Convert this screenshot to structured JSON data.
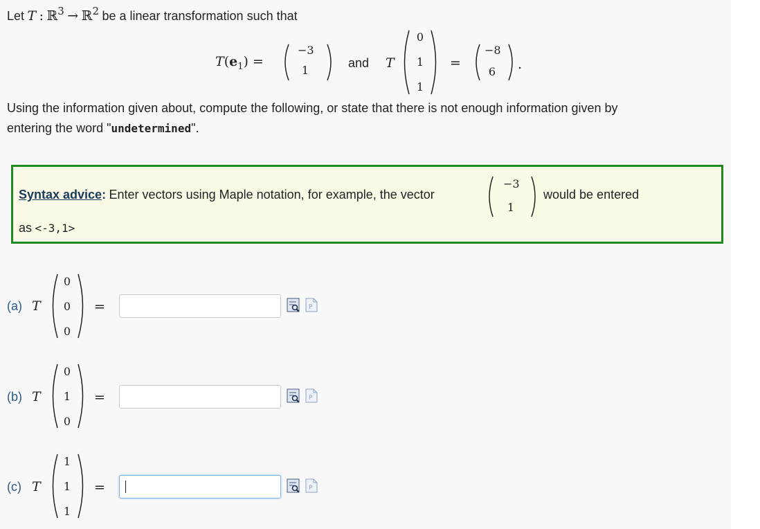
{
  "problem": {
    "intro_let": "Let",
    "T": "T",
    "colon": ":",
    "R": "ℝ",
    "dim3": "3",
    "arrow": "→",
    "dim2": "2",
    "intro_rest": "be a linear transformation such that",
    "te1_T": "T",
    "te1_open": "(",
    "te1_e": "e",
    "te1_sub": "1",
    "te1_close": ") =",
    "vec_e1_image": [
      "−3",
      "1"
    ],
    "and": "and",
    "given_T": "T",
    "given_input": [
      "0",
      "1",
      "1"
    ],
    "equals": "=",
    "given_output": [
      "−8",
      "6"
    ],
    "period": ".",
    "instruction_line1": "Using the information given about, compute the following, or state that there is not enough information given by",
    "instruction_line2_pre": "entering the word \"",
    "instruction_keyword": "undetermined",
    "instruction_line2_post": "\"."
  },
  "syntax_advice": {
    "link_label": "Syntax advice",
    "colon": ":",
    "text": "Enter vectors using Maple notation, for example, the vector",
    "example_vector": [
      "−3",
      "1"
    ],
    "text_after": "would be entered",
    "line2_prefix": "as",
    "example_code": "<-3,1>"
  },
  "parts": [
    {
      "label": "(a)",
      "T": "T",
      "vector": [
        "0",
        "0",
        "0"
      ],
      "equals": "=",
      "value": "",
      "focused": false
    },
    {
      "label": "(b)",
      "T": "T",
      "vector": [
        "0",
        "1",
        "0"
      ],
      "equals": "=",
      "value": "",
      "focused": false
    },
    {
      "label": "(c)",
      "T": "T",
      "vector": [
        "1",
        "1",
        "1"
      ],
      "equals": "=",
      "value": "",
      "focused": true
    }
  ],
  "icons": {
    "preview": "preview-icon",
    "maple_help": "maple-syntax-help-icon"
  },
  "colors": {
    "advice_border": "#1f8a1f",
    "advice_bg": "#fafae6",
    "label_blue": "#2a5a8a",
    "focus_border": "#7fb1e0"
  }
}
